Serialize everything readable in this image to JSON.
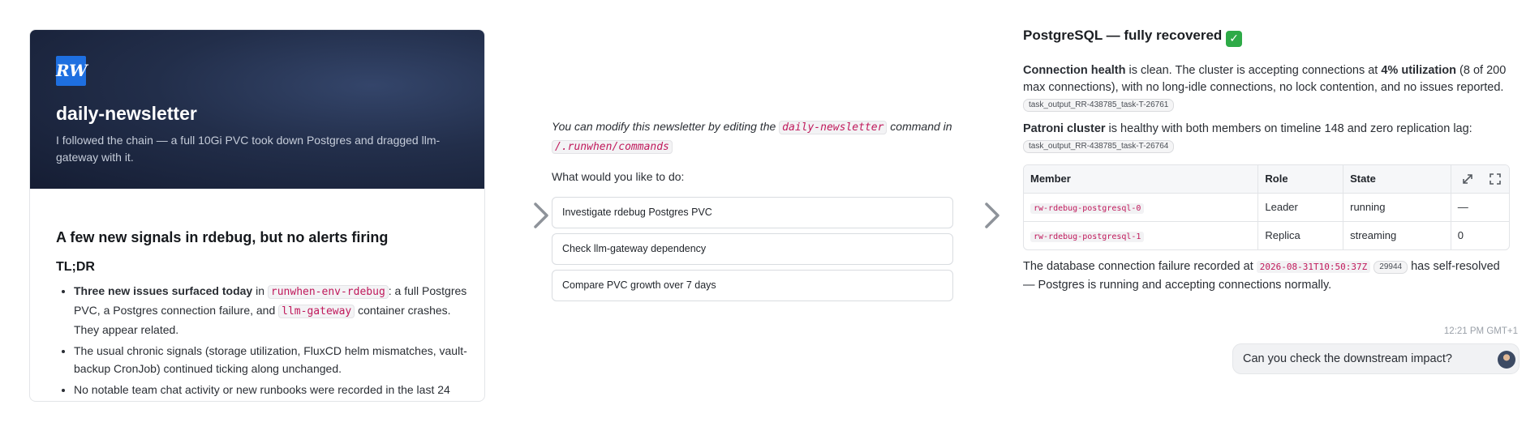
{
  "newsletter": {
    "logo_text": "RW",
    "title": "daily-newsletter",
    "subtitle": "I followed the chain — a full 10Gi PVC took down Postgres and dragged llm-gateway with it.",
    "headline": "A few new signals in rdebug, but no alerts firing",
    "tldr": "TL;DR",
    "bullet1": {
      "bold": "Three new issues surfaced today",
      "pre": " in ",
      "code1": "runwhen-env-rdebug",
      "mid": ": a full Postgres PVC, a Postgres connection failure, and ",
      "code2": "llm-gateway",
      "post": " container crashes. They appear related."
    },
    "bullet2": "The usual chronic signals (storage utilization, FluxCD helm mismatches, vault-backup CronJob) continued ticking along unchanged.",
    "bullet3": "No notable team chat activity or new runbooks were recorded in the last 24"
  },
  "options_panel": {
    "intro_pre": "You can modify this newsletter by editing the ",
    "intro_code": "daily-newsletter",
    "intro_mid": " command in ",
    "intro_path": "/.runwhen/commands",
    "question": "What would you like to do:",
    "options": [
      "Investigate rdebug Postgres PVC",
      "Check llm-gateway dependency",
      "Compare PVC growth over 7 days"
    ]
  },
  "chat": {
    "title": "PostgreSQL — fully recovered",
    "title_emoji": "✓",
    "conn_bold": "Connection health",
    "conn_text1": " is clean. The cluster is accepting connections at ",
    "conn_util": "4% utilization",
    "conn_text2": " (8 of 200 max connections), with no long-idle connections, no lock contention, and no issues reported.",
    "conn_tag": "task_output_RR-438785_task-T-26761",
    "patroni_bold": "Patroni cluster",
    "patroni_text": " is healthy with both members on timeline 148 and zero replication lag:",
    "patroni_tag": "task_output_RR-438785_task-T-26764",
    "table": {
      "headers": [
        "Member",
        "Role",
        "State",
        ""
      ],
      "rows": [
        [
          "rw-rdebug-postgresql-0",
          "Leader",
          "running",
          "—"
        ],
        [
          "rw-rdebug-postgresql-1",
          "Replica",
          "streaming",
          "0"
        ]
      ]
    },
    "after_pre": "The database connection failure recorded at ",
    "after_ts": "2026-08-31T10:50:37Z",
    "after_tag": "29944",
    "after_post": " has self-resolved — Postgres is running and accepting connections normally.",
    "timestamp": "12:21 PM GMT+1",
    "user_message": "Can you check the downstream impact?"
  },
  "icons": {
    "expand": "expand-icon",
    "fullscreen": "fullscreen-icon",
    "arrow": "chevron-right-icon"
  }
}
